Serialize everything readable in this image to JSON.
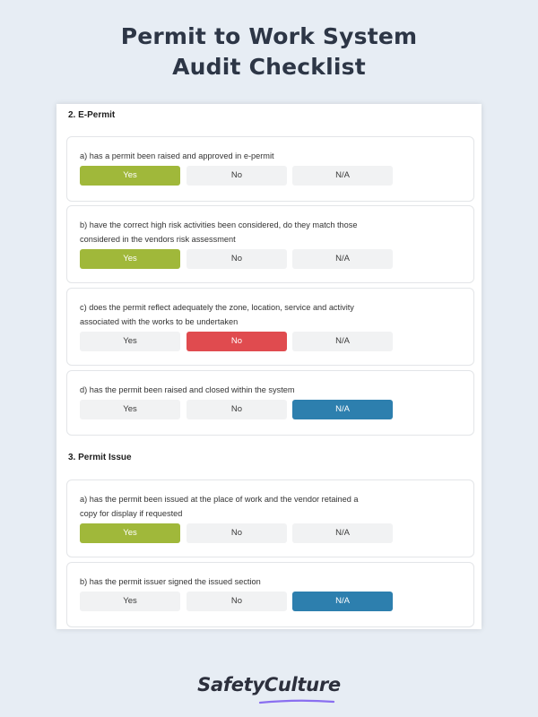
{
  "page": {
    "title_line1": "Permit to Work System",
    "title_line2": "Audit Checklist"
  },
  "sections": [
    {
      "title": "2. E-Permit",
      "questions": [
        {
          "line1": "a) has a permit been raised and approved in e-permit",
          "line2": "",
          "options": [
            "Yes",
            "No",
            "N/A"
          ],
          "selected": "Yes"
        },
        {
          "line1": "b) have the correct high risk activities been considered, do they match those",
          "line2": "considered in the vendors risk assessment",
          "options": [
            "Yes",
            "No",
            "N/A"
          ],
          "selected": "Yes"
        },
        {
          "line1": "c) does the permit reflect adequately the zone, location, service and activity",
          "line2": "associated with the works to be undertaken",
          "options": [
            "Yes",
            "No",
            "N/A"
          ],
          "selected": "No"
        },
        {
          "line1": "d) has the permit been raised and closed within the system",
          "line2": "",
          "options": [
            "Yes",
            "No",
            "N/A"
          ],
          "selected": "N/A"
        }
      ]
    },
    {
      "title": "3. Permit Issue",
      "questions": [
        {
          "line1": "a) has the permit been issued at the place of work and the vendor retained a",
          "line2": "copy for display if requested",
          "options": [
            "Yes",
            "No",
            "N/A"
          ],
          "selected": "Yes"
        },
        {
          "line1": "b) has the permit issuer signed the issued section",
          "line2": "",
          "options": [
            "Yes",
            "No",
            "N/A"
          ],
          "selected": "N/A"
        }
      ]
    }
  ],
  "brand": {
    "name": "SafetyCulture"
  },
  "colors": {
    "background": "#e7edf4",
    "yes_selected": "#a0b83a",
    "no_selected": "#e04b4f",
    "na_selected": "#2d7fae",
    "unselected": "#f1f2f3",
    "brand_underline": "#8a6ff0"
  }
}
